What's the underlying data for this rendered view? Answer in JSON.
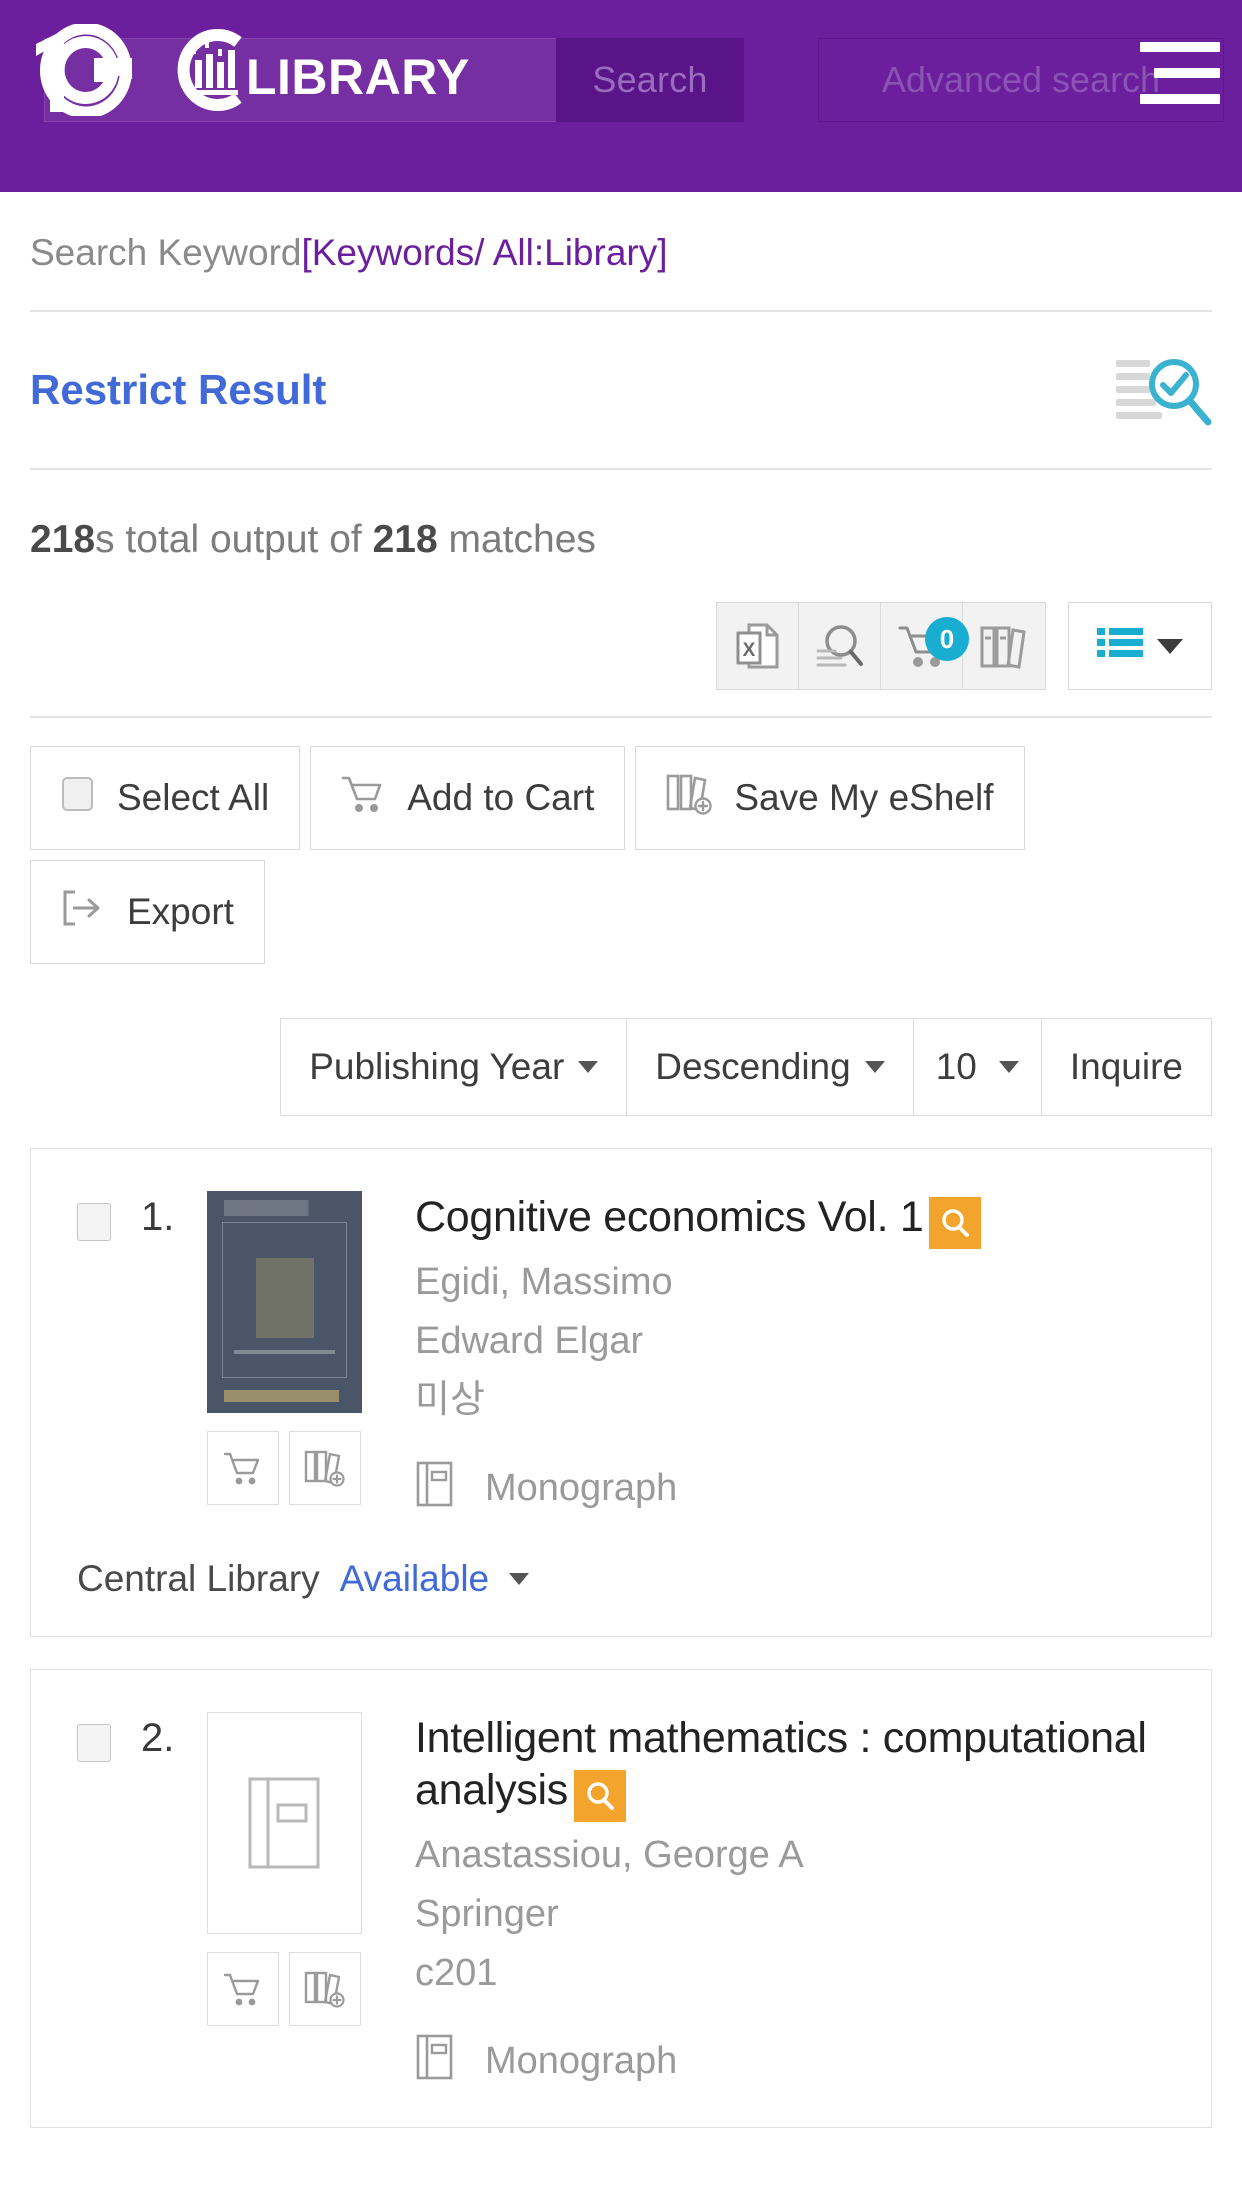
{
  "header": {
    "logo_text": "LIBRARY",
    "logo_mark": "1GC",
    "search_placeholder": "",
    "search_value": "",
    "search_button": "Search",
    "advanced_search": "Advanced search",
    "menu_icon": "hamburger-menu-icon",
    "brand_color": "#6C1F9C"
  },
  "keyword": {
    "label": "Search Keyword",
    "value": "[Keywords/ All:Library]"
  },
  "restrict": {
    "label": "Restrict Result",
    "icon": "list-search-check-icon",
    "icon_color": "#3BB2D0"
  },
  "summary": {
    "count_prefix": "218",
    "mid_text": "s total output of ",
    "count_total": "218",
    "suffix": " matches"
  },
  "toolbar": {
    "buttons": [
      {
        "name": "excel-export-icon",
        "label": "Excel"
      },
      {
        "name": "search-results-icon",
        "label": "Search in results"
      },
      {
        "name": "cart-icon",
        "label": "Cart",
        "badge": "0"
      },
      {
        "name": "eshelf-icon",
        "label": "My eShelf"
      }
    ],
    "view_toggle": {
      "name": "list-view-icon",
      "label": "List view"
    },
    "badge_color": "#19AED1",
    "accent_color": "#19AED1"
  },
  "actions": [
    {
      "label": "Select All",
      "icon": "checkbox-icon"
    },
    {
      "label": "Add to Cart",
      "icon": "cart-icon"
    },
    {
      "label": "Save My eShelf",
      "icon": "eshelf-add-icon"
    },
    {
      "label": "Export",
      "icon": "export-icon"
    }
  ],
  "sort": {
    "field": "Publishing Year",
    "order": "Descending",
    "per_page": "10",
    "submit": "Inquire"
  },
  "results": [
    {
      "number": "1.",
      "title": "Cognitive economics Vol. 1",
      "has_preview_badge": true,
      "badge_icon": "magnifier-icon",
      "badge_color": "#F2A42C",
      "author": "Egidi, Massimo",
      "publisher": "Edward Elgar",
      "year": "미상",
      "material_type": "Monograph",
      "material_icon": "book-icon",
      "cover": "dark-cover",
      "holding_library": "Central Library",
      "holding_status": "Available",
      "mini_buttons": [
        "cart-icon",
        "eshelf-add-icon"
      ]
    },
    {
      "number": "2.",
      "title": "Intelligent mathematics : computational analysis",
      "has_preview_badge": true,
      "badge_icon": "magnifier-icon",
      "badge_color": "#F2A42C",
      "author": "Anastassiou, George A",
      "publisher": "Springer",
      "year": "c201",
      "material_type": "Monograph",
      "material_icon": "book-icon",
      "cover": "placeholder-cover",
      "mini_buttons": [
        "cart-icon",
        "eshelf-add-icon"
      ]
    }
  ]
}
